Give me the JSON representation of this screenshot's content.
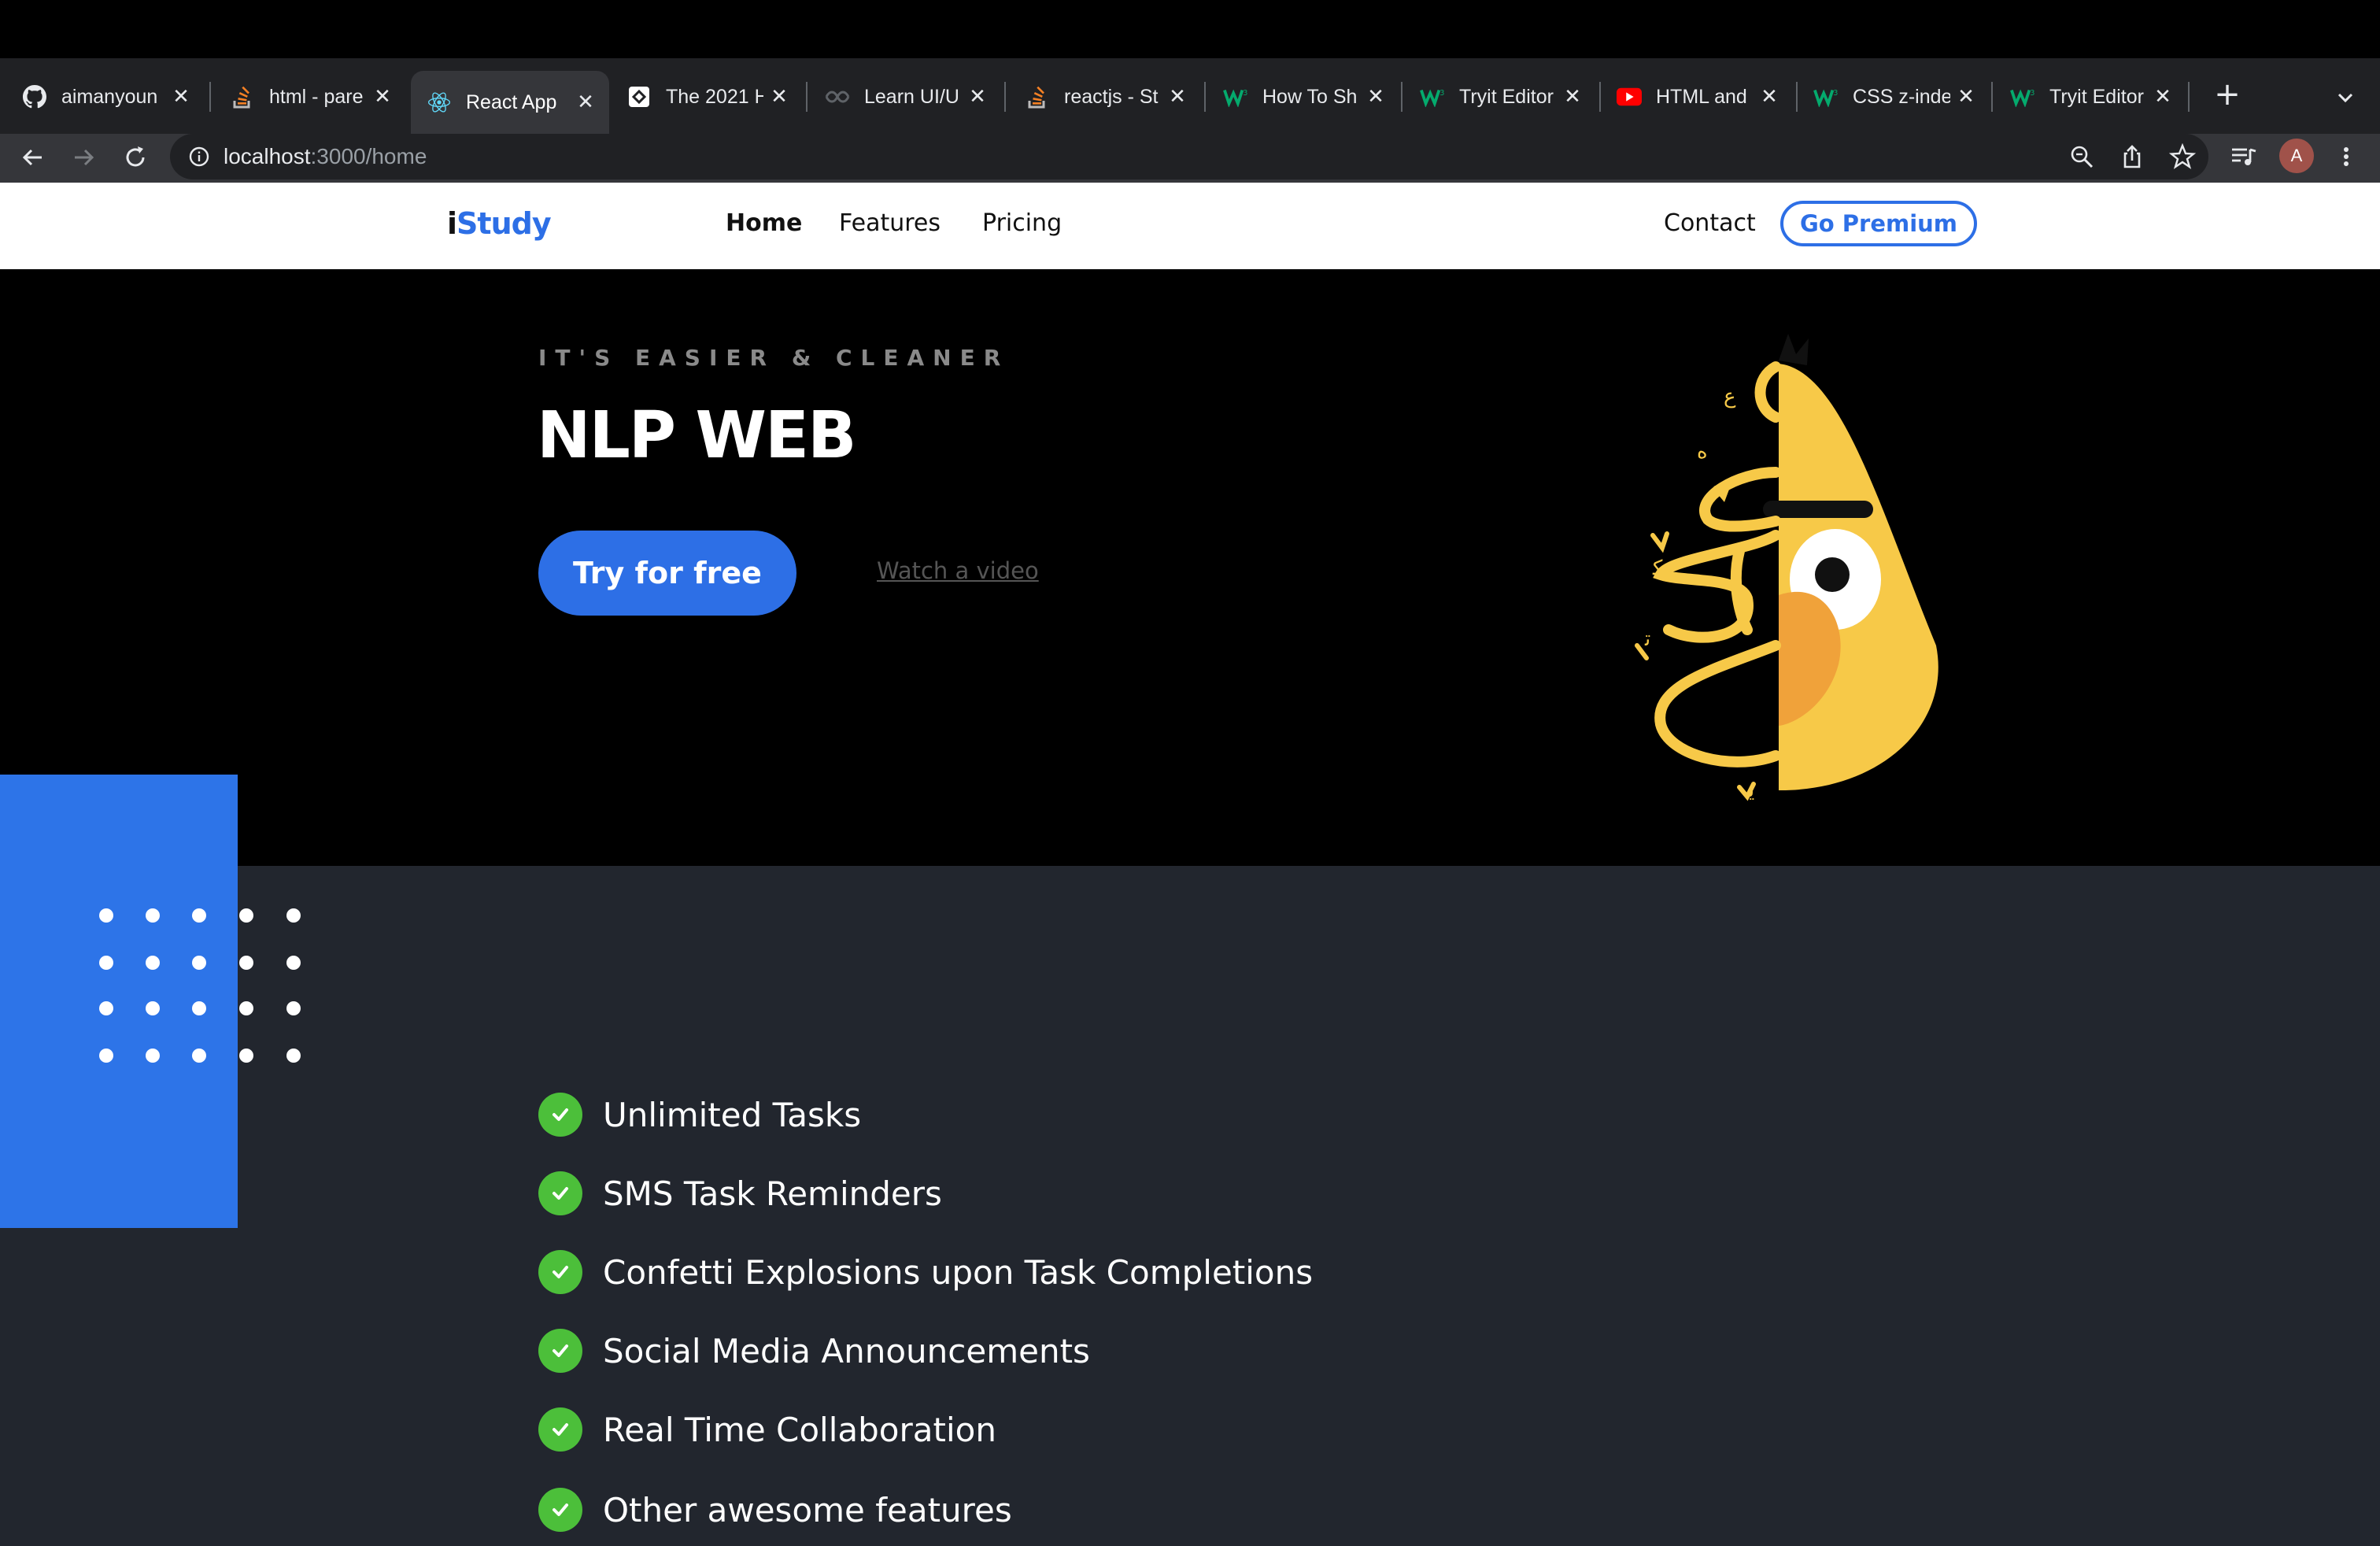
{
  "browser": {
    "tabs": [
      {
        "title": "aimanyoun",
        "icon": "github-icon"
      },
      {
        "title": "html - pare",
        "icon": "stackoverflow-icon"
      },
      {
        "title": "React App",
        "icon": "react-icon",
        "active": true
      },
      {
        "title": "The 2021 H",
        "icon": "app-icon"
      },
      {
        "title": "Learn UI/U",
        "icon": "link-icon"
      },
      {
        "title": "reactjs - St",
        "icon": "stackoverflow-icon"
      },
      {
        "title": "How To Sh",
        "icon": "w3schools-icon"
      },
      {
        "title": "Tryit Editor",
        "icon": "w3schools-icon"
      },
      {
        "title": "HTML and",
        "icon": "youtube-icon"
      },
      {
        "title": "CSS z-inde",
        "icon": "w3schools-icon"
      },
      {
        "title": "Tryit Editor",
        "icon": "w3schools-icon"
      }
    ],
    "url_host": "localhost",
    "url_path": ":3000/home",
    "profile_initial": "A"
  },
  "header": {
    "logo_i": "i",
    "logo_rest": "Study",
    "nav": [
      "Home",
      "Features",
      "Pricing"
    ],
    "contact": "Contact",
    "premium": "Go Premium"
  },
  "hero": {
    "eyebrow": "IT'S EASIER & CLEANER",
    "title": "NLP WEB",
    "cta": "Try for free",
    "video_link": "Watch a video"
  },
  "features": {
    "items": [
      "Unlimited Tasks",
      "SMS Task Reminders",
      "Confetti Explosions upon Task Completions",
      "Social Media Announcements",
      "Real Time Collaboration",
      "Other awesome features"
    ]
  },
  "colors": {
    "accent": "#2d6fe6",
    "check": "#4cbf3a",
    "hero_bg": "#000000",
    "features_bg": "#22262e",
    "art_yellow": "#f7c948",
    "art_orange": "#f0a23a"
  }
}
